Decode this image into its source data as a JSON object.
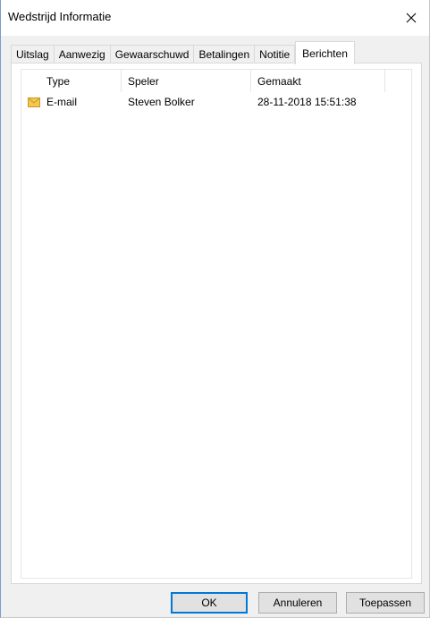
{
  "window": {
    "title": "Wedstrijd Informatie",
    "close_label": "×"
  },
  "tabs": [
    {
      "label": "Uitslag",
      "active": false
    },
    {
      "label": "Aanwezig",
      "active": false
    },
    {
      "label": "Gewaarschuwd",
      "active": false
    },
    {
      "label": "Betalingen",
      "active": false
    },
    {
      "label": "Notitie",
      "active": false
    },
    {
      "label": "Berichten",
      "active": true
    }
  ],
  "list": {
    "columns": [
      "Type",
      "Speler",
      "Gemaakt"
    ],
    "rows": [
      {
        "icon": "envelope-icon",
        "type": "E-mail",
        "speler": "Steven Bolker",
        "gemaakt": "28-11-2018 15:51:38"
      }
    ]
  },
  "buttons": {
    "ok": "OK",
    "cancel": "Annuleren",
    "apply": "Toepassen"
  },
  "colors": {
    "dialog_bg": "#f0f0f0",
    "accent": "#0078d7",
    "envelope": "#f2c94c"
  }
}
